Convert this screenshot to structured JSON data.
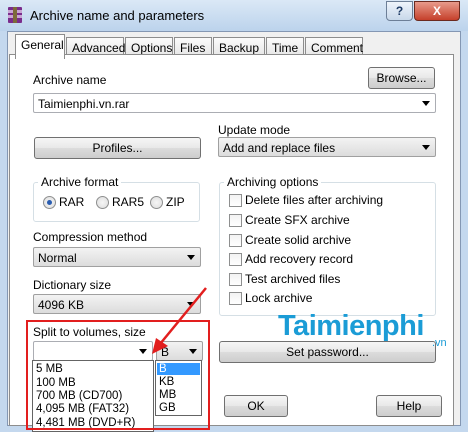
{
  "window": {
    "title": "Archive name and parameters",
    "help_symbol": "?",
    "close_symbol": "X"
  },
  "tabs": [
    "General",
    "Advanced",
    "Options",
    "Files",
    "Backup",
    "Time",
    "Comment"
  ],
  "archive_name": {
    "label": "Archive name",
    "value": "Taimienphi.vn.rar",
    "browse_label": "Browse..."
  },
  "profiles_label": "Profiles...",
  "update_mode": {
    "label": "Update mode",
    "value": "Add and replace files"
  },
  "archive_format": {
    "title": "Archive format",
    "options": [
      "RAR",
      "RAR5",
      "ZIP"
    ],
    "selected": "RAR"
  },
  "archiving_options": {
    "title": "Archiving options",
    "items": [
      {
        "label": "Delete files after archiving",
        "checked": false
      },
      {
        "label": "Create SFX archive",
        "checked": false
      },
      {
        "label": "Create solid archive",
        "checked": false
      },
      {
        "label": "Add recovery record",
        "checked": false
      },
      {
        "label": "Test archived files",
        "checked": false
      },
      {
        "label": "Lock archive",
        "checked": false
      }
    ]
  },
  "compression": {
    "label": "Compression method",
    "value": "Normal"
  },
  "dictionary": {
    "label": "Dictionary size",
    "value": "4096 KB"
  },
  "split": {
    "label": "Split to volumes, size",
    "value": "",
    "unit": "B",
    "size_options": [
      "5 MB",
      "100 MB",
      "700 MB  (CD700)",
      "4,095 MB  (FAT32)",
      "4,481 MB  (DVD+R)"
    ],
    "unit_options": [
      "B",
      "KB",
      "MB",
      "GB"
    ],
    "selected_unit": "B"
  },
  "set_password_label": "Set password...",
  "buttons": {
    "ok": "OK",
    "help": "Help"
  },
  "watermark": {
    "text": "Taimienphi",
    "suffix": ".vn"
  },
  "colors": {
    "highlight": "#e21e1e",
    "selection": "#3399ff",
    "watermark": "#1b9cd6"
  }
}
